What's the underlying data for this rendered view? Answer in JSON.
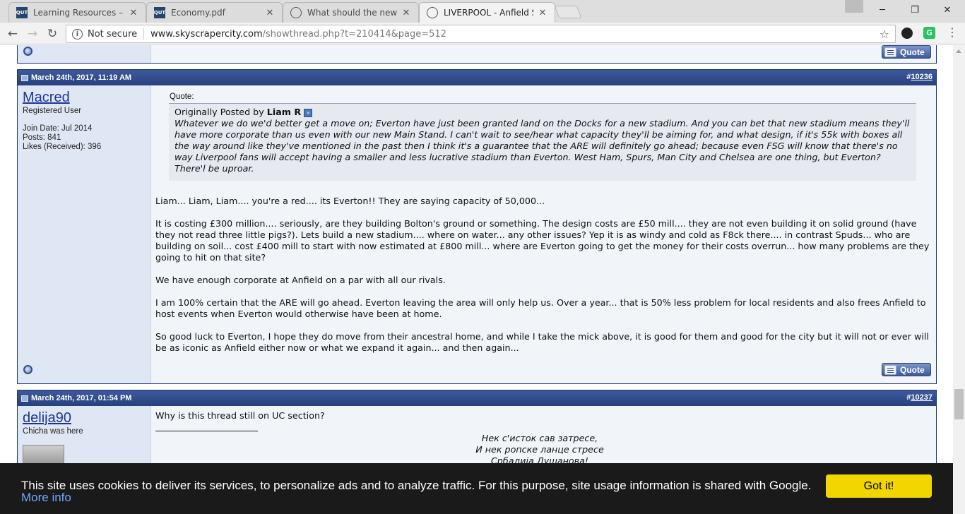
{
  "browser": {
    "tabs": [
      {
        "title": "Learning Resources – UX",
        "favicon": "qut-icon"
      },
      {
        "title": "Economy.pdf",
        "favicon": "qut-icon"
      },
      {
        "title": "What should the new sta",
        "favicon": "globe-icon"
      },
      {
        "title": "LIVERPOOL - Anfield Stad",
        "favicon": "skyscrapercity-icon"
      }
    ],
    "window_controls": {
      "minimize": "─",
      "restore": "❐",
      "close": "✕"
    },
    "omnibox": {
      "security_label": "Not secure",
      "url_domain": "www.skyscrapercity.com",
      "url_path": "/showthread.php?t=210414&page=512"
    },
    "icons": [
      "back-icon",
      "forward-icon",
      "reload-icon",
      "info-icon",
      "bookmark-star-icon",
      "menu-icon"
    ]
  },
  "posts": [
    {
      "date": "March 24th, 2017, 11:19 AM",
      "number_prefix": "#",
      "number": "10236",
      "username": "Macred",
      "user_title": "Registered User",
      "join_date": "Join Date: Jul 2014",
      "posts": "Posts: 841",
      "likes": "Likes (Received): 396",
      "quote": {
        "label": "Quote:",
        "originally_posted_by": "Originally Posted by",
        "author": "Liam R",
        "text": "Whatever we do we'd better get a move on; Everton have just been granted land on the Docks for a new stadium. And you can bet that new stadium means they'll have more corporate than us even with our new Main Stand. I can't wait to see/hear what capacity they'll be aiming for, and what design, if it's 55k with boxes all the way around like they've mentioned in the past then I think it's a guarantee that the ARE will definitely go ahead; because even FSG will know that there's no way Liverpool fans will accept having a smaller and less lucrative stadium than Everton. West Ham, Spurs, Man City and Chelsea are one thing, but Everton? There'l be uproar."
      },
      "paragraphs": [
        "Liam... Liam, Liam.... you're a red.... its Everton!! They are saying capacity of 50,000...",
        "It is costing £300 million.... seriously, are they building Bolton's ground or something. The design costs are £50 mill.... they are not even building it on solid ground (have they not read three little pigs?). Lets build a new stadium.... where on water... any other issues? Yep it is as windy and cold as F8ck there.... in contrast Spuds... who are building on soil... cost £400 mill to start with now estimated at £800 mill... where are Everton going to get the money for their costs overrun... how many problems are they going to hit on that site?",
        "We have enough corporate at Anfield on a par with all our rivals.",
        "I am 100% certain that the ARE will go ahead. Everton leaving the area will only help us. Over a year... that is 50% less problem for local residents and also frees Anfield to host events when Everton would otherwise have been at home.",
        "So good luck to Everton, I hope they do move from their ancestral home, and while I take the mick above, it is good for them and good for the city but it will not or ever will be as iconic as Anfield either now or what we expand it again... and then again..."
      ],
      "quote_button": "Quote"
    },
    {
      "date": "March 24th, 2017, 01:54 PM",
      "number_prefix": "#",
      "number": "10237",
      "username": "delija90",
      "user_title": "Chicha was here",
      "message": "Why is this thread still on UC section?",
      "signature": [
        "Нек с'исток сав затресе,",
        "И нек ропске ланце стресе",
        "Србадија Душанова!"
      ]
    }
  ],
  "top_quote_button": "Quote",
  "cookie_bar": {
    "text": "This site uses cookies to deliver its services, to personalize ads and to analyze traffic. For this purpose, site usage information is shared with Google.",
    "link": "More info",
    "button": "Got it!"
  },
  "colors": {
    "post_header": "#27407f",
    "username": "#1f3596",
    "cookie_button": "#f1d600",
    "cookie_bg": "#1a1a1a"
  }
}
